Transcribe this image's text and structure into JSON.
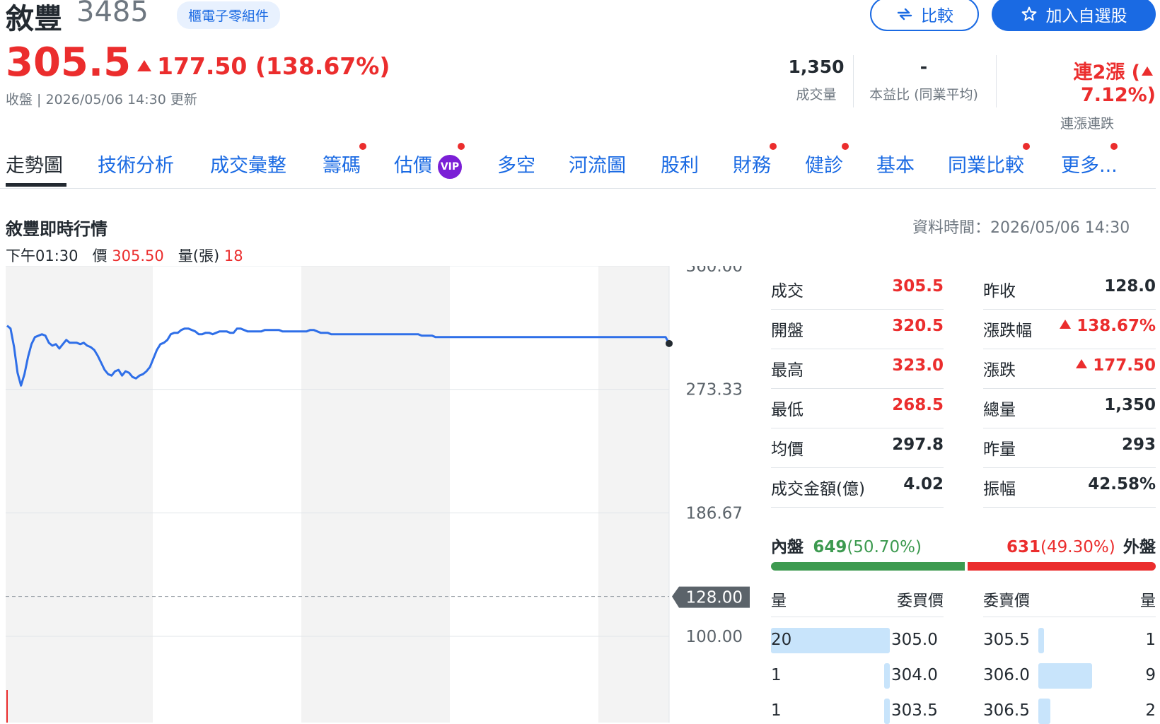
{
  "header": {
    "stock_name": "敘豐",
    "stock_code": "3485",
    "industry_tag": "櫃電子零組件",
    "compare_label": "比較",
    "watchlist_label": "加入自選股",
    "price": "305.5",
    "change": "177.50 (138.67%)",
    "update_time": "收盤 | 2026/05/06 14:30 更新"
  },
  "kpis": {
    "volume_value": "1,350",
    "volume_label": "成交量",
    "pe_value": "-",
    "pe_label": "本益比 (同業平均)",
    "streak_value_prefix": "連2漲 (",
    "streak_value_pct": "7.12%)",
    "streak_label": "連漲連跌"
  },
  "tabs": [
    {
      "label": "走勢圖"
    },
    {
      "label": "技術分析"
    },
    {
      "label": "成交彙整"
    },
    {
      "label": "籌碼"
    },
    {
      "label": "估價"
    },
    {
      "label": "多空"
    },
    {
      "label": "河流圖"
    },
    {
      "label": "股利"
    },
    {
      "label": "財務"
    },
    {
      "label": "健診"
    },
    {
      "label": "基本"
    },
    {
      "label": "同業比較"
    },
    {
      "label": "更多..."
    }
  ],
  "vip_badge": "VIP",
  "realtime": {
    "title": "敘豐即時行情",
    "data_time": "資料時間：2026/05/06 14:30",
    "hover_time": "下午01:30",
    "hover_price_label": "價",
    "hover_price": "305.50",
    "hover_vol_label": "量(張)",
    "hover_vol": "18"
  },
  "chart_data": {
    "type": "line",
    "y_ticks": [
      "360.00",
      "273.33",
      "186.67",
      "100.00"
    ],
    "ylim": [
      100,
      360
    ],
    "prev_close_label": "128.00",
    "prev_close": 128.0,
    "series": [
      {
        "values": [
          318,
          316,
          303,
          285,
          276,
          284,
          296,
          305,
          310,
          311,
          312,
          311,
          306,
          304,
          305,
          302,
          305,
          308,
          306,
          306,
          306,
          305,
          306,
          304,
          303,
          301,
          297,
          292,
          287,
          284,
          283,
          286,
          287,
          283,
          286,
          285,
          282,
          281,
          283,
          284,
          286,
          289,
          295,
          301,
          305,
          306,
          308,
          312,
          313,
          313,
          315,
          316,
          316,
          315,
          314,
          312,
          312,
          313,
          313,
          312,
          313,
          314,
          314,
          314,
          313,
          313,
          316,
          316,
          315,
          314,
          314,
          314,
          314,
          314,
          315,
          315,
          315,
          315,
          315,
          314,
          314,
          314,
          314,
          314,
          314,
          314,
          314,
          315,
          315,
          314,
          313,
          313,
          313,
          312,
          312,
          312,
          312,
          312,
          312,
          312,
          312,
          312,
          312,
          312,
          312,
          312,
          312,
          312,
          312,
          312,
          312,
          312,
          312,
          312,
          312,
          312,
          312,
          312,
          312,
          311,
          311,
          311,
          311,
          310,
          310,
          310,
          310,
          310,
          310,
          310,
          310,
          310,
          310,
          310,
          310,
          310,
          310,
          310,
          310,
          310,
          310,
          310,
          310,
          310,
          310,
          310,
          310,
          310,
          310,
          310,
          310,
          310,
          310,
          310,
          310,
          310,
          310,
          310,
          310,
          310,
          310,
          310,
          310,
          310,
          310,
          310,
          310,
          310,
          310,
          310,
          310,
          310,
          310,
          310,
          310,
          310,
          310,
          310,
          310,
          310,
          310,
          310,
          310,
          310,
          310,
          310,
          310,
          310,
          310,
          310,
          305.5
        ]
      }
    ]
  },
  "quote": {
    "left": [
      {
        "label": "成交",
        "value": "305.5",
        "color": "#eb2d2d"
      },
      {
        "label": "開盤",
        "value": "320.5",
        "color": "#eb2d2d"
      },
      {
        "label": "最高",
        "value": "323.0",
        "color": "#eb2d2d"
      },
      {
        "label": "最低",
        "value": "268.5",
        "color": "#eb2d2d"
      },
      {
        "label": "均價",
        "value": "297.8",
        "color": "#232a31"
      },
      {
        "label": "成交金額(億)",
        "value": "4.02",
        "color": "#232a31"
      }
    ],
    "right": [
      {
        "label": "昨收",
        "value": "128.0",
        "color": "#232a31",
        "arrow": false
      },
      {
        "label": "漲跌幅",
        "value": "138.67%",
        "color": "#eb2d2d",
        "arrow": true
      },
      {
        "label": "漲跌",
        "value": "177.50",
        "color": "#eb2d2d",
        "arrow": true
      },
      {
        "label": "總量",
        "value": "1,350",
        "color": "#232a31",
        "arrow": false
      },
      {
        "label": "昨量",
        "value": "293",
        "color": "#232a31",
        "arrow": false
      },
      {
        "label": "振幅",
        "value": "42.58%",
        "color": "#232a31",
        "arrow": false
      }
    ]
  },
  "inner_outer": {
    "inner_label": "內盤",
    "inner_value": "649",
    "inner_pct": "(50.70%)",
    "outer_value": "631",
    "outer_pct": "(49.30%)",
    "outer_label": "外盤",
    "inner_share": 0.507
  },
  "order_book": {
    "head_qty": "量",
    "head_bid": "委買價",
    "head_ask": "委賣價",
    "head_qty2": "量",
    "rows": [
      {
        "bid_qty": "20",
        "bid_price": "305.0",
        "ask_price": "305.5",
        "ask_qty": "1",
        "bid_share": 1.0,
        "ask_share": 0.11
      },
      {
        "bid_qty": "1",
        "bid_price": "304.0",
        "ask_price": "306.0",
        "ask_qty": "9",
        "bid_share": 0.05,
        "ask_share": 1.0
      },
      {
        "bid_qty": "1",
        "bid_price": "303.5",
        "ask_price": "306.5",
        "ask_qty": "2",
        "bid_share": 0.05,
        "ask_share": 0.22
      }
    ]
  }
}
